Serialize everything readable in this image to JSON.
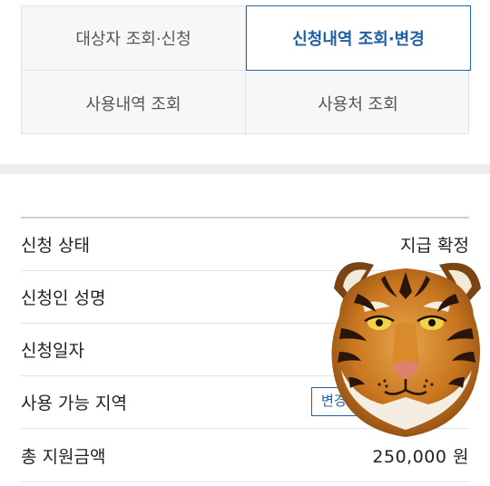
{
  "tabs": [
    {
      "label": "대상자 조회·신청",
      "active": false
    },
    {
      "label": "신청내역 조회·변경",
      "active": true
    },
    {
      "label": "사용내역 조회",
      "active": false
    },
    {
      "label": "사용처 조회",
      "active": false
    }
  ],
  "info": {
    "rows": [
      {
        "label": "신청 상태",
        "value": "지급 확정"
      },
      {
        "label": "신청인 성명",
        "value": ""
      },
      {
        "label": "신청일자",
        "value": ""
      },
      {
        "label": "사용 가능 지역",
        "value": "",
        "button": "변경하기"
      },
      {
        "label": "총 지원금액",
        "value": "250,000 원"
      }
    ]
  },
  "colors": {
    "accent": "#1d5fa3",
    "tab_bg": "#f7f7f7",
    "band": "#ececec"
  },
  "icons": {
    "overlay": "tiger-face-sticker"
  }
}
